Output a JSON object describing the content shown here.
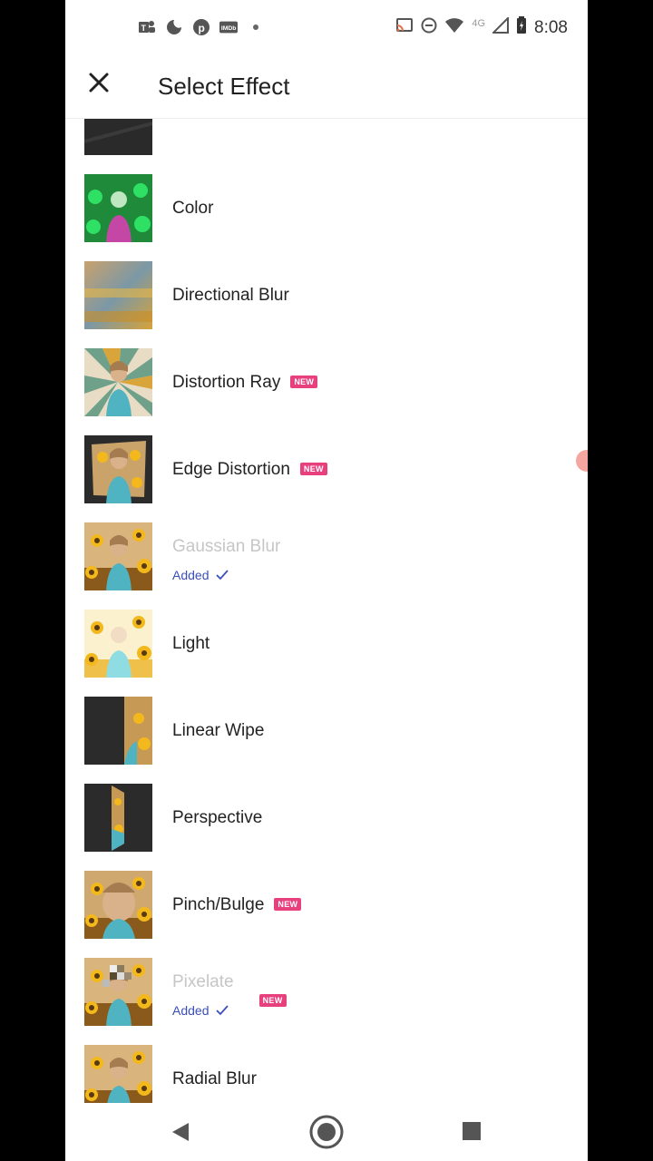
{
  "status_bar": {
    "time": "8:08",
    "left_icons": [
      "teams-icon",
      "moon-icon",
      "pinterest-icon",
      "imdb-icon",
      "dot-icon"
    ],
    "right_icons": [
      "cast-icon",
      "dnd-icon",
      "wifi-icon",
      "4g-icon",
      "signal-icon",
      "battery-icon"
    ],
    "network_label": "4G"
  },
  "toolbar": {
    "title": "Select Effect",
    "close_icon": "close-icon"
  },
  "effects": [
    {
      "name": "",
      "new": false,
      "added": false,
      "thumb": "dark"
    },
    {
      "name": "Color",
      "new": false,
      "added": false,
      "thumb": "green"
    },
    {
      "name": "Directional Blur",
      "new": false,
      "added": false,
      "thumb": "blur"
    },
    {
      "name": "Distortion Ray",
      "new": true,
      "added": false,
      "thumb": "ray"
    },
    {
      "name": "Edge Distortion",
      "new": true,
      "added": false,
      "thumb": "edge"
    },
    {
      "name": "Gaussian Blur",
      "new": false,
      "added": true,
      "thumb": "sun"
    },
    {
      "name": "Light",
      "new": false,
      "added": false,
      "thumb": "light"
    },
    {
      "name": "Linear Wipe",
      "new": false,
      "added": false,
      "thumb": "wipe"
    },
    {
      "name": "Perspective",
      "new": false,
      "added": false,
      "thumb": "perspective"
    },
    {
      "name": "Pinch/Bulge",
      "new": true,
      "added": false,
      "thumb": "pinch"
    },
    {
      "name": "Pixelate",
      "new": true,
      "added": true,
      "thumb": "pixel"
    },
    {
      "name": "Radial Blur",
      "new": false,
      "added": false,
      "thumb": "sun"
    }
  ],
  "labels": {
    "new_badge": "NEW",
    "added_text": "Added"
  },
  "colors": {
    "badge": "#e83f7d",
    "added": "#3b4fb8",
    "disabled": "#c6c6c6"
  }
}
